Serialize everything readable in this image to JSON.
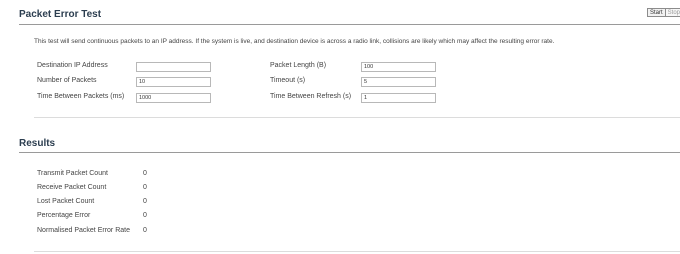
{
  "header": {
    "title": "Packet Error Test",
    "buttons": {
      "start": "Start",
      "stop": "Stop"
    }
  },
  "description": "This test will send continuous packets to an IP address. If the system is live, and destination device is across a radio link, collisions are likely which may affect the resulting error rate.",
  "form": {
    "destination_ip": {
      "label": "Destination IP Address",
      "value": ""
    },
    "packet_length": {
      "label": "Packet Length (B)",
      "value": "100"
    },
    "number_of_packets": {
      "label": "Number of Packets",
      "value": "10"
    },
    "timeout": {
      "label": "Timeout (s)",
      "value": "5"
    },
    "time_between_packets": {
      "label": "Time Between Packets (ms)",
      "value": "1000"
    },
    "time_between_refresh": {
      "label": "Time Between Refresh (s)",
      "value": "1"
    }
  },
  "results": {
    "title": "Results",
    "rows": [
      {
        "label": "Transmit Packet Count",
        "value": "0"
      },
      {
        "label": "Receive Packet Count",
        "value": "0"
      },
      {
        "label": "Lost Packet Count",
        "value": "0"
      },
      {
        "label": "Percentage Error",
        "value": "0"
      },
      {
        "label": "Normalised Packet Error Rate",
        "value": "0"
      }
    ]
  }
}
